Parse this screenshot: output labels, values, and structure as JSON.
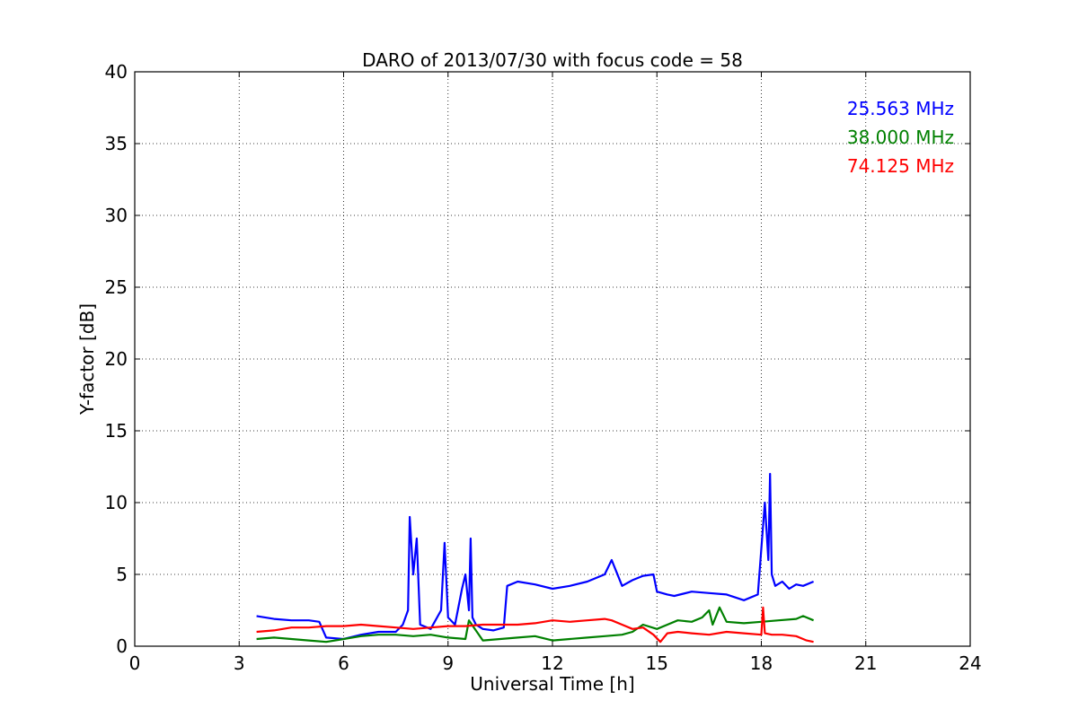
{
  "chart_data": {
    "type": "line",
    "title": "DARO of 2013/07/30 with focus code = 58",
    "xlabel": "Universal Time [h]",
    "ylabel": "Y-factor [dB]",
    "xlim": [
      0,
      24
    ],
    "ylim": [
      0,
      40
    ],
    "xticks": [
      0,
      3,
      6,
      9,
      12,
      15,
      18,
      21,
      24
    ],
    "yticks": [
      0,
      5,
      10,
      15,
      20,
      25,
      30,
      35,
      40
    ],
    "xtick_labels": [
      "0",
      "3",
      "6",
      "9",
      "12",
      "15",
      "18",
      "21",
      "24"
    ],
    "ytick_labels": [
      "0",
      "5",
      "10",
      "15",
      "20",
      "25",
      "30",
      "35",
      "40"
    ],
    "grid": true,
    "legend_position": "top-right",
    "series": [
      {
        "name": "25.563 MHz",
        "color": "#0000ff",
        "x": [
          3.5,
          4.0,
          4.5,
          5.0,
          5.3,
          5.5,
          6.0,
          6.5,
          7.0,
          7.5,
          7.7,
          7.85,
          7.9,
          8.0,
          8.1,
          8.2,
          8.5,
          8.8,
          8.9,
          9.0,
          9.2,
          9.4,
          9.5,
          9.6,
          9.65,
          9.7,
          9.8,
          10.0,
          10.3,
          10.6,
          10.7,
          11.0,
          11.5,
          12.0,
          12.5,
          13.0,
          13.5,
          13.7,
          14.0,
          14.3,
          14.6,
          14.9,
          15.0,
          15.3,
          15.5,
          16.0,
          16.5,
          17.0,
          17.5,
          17.9,
          18.1,
          18.2,
          18.25,
          18.3,
          18.4,
          18.6,
          18.8,
          19.0,
          19.2,
          19.5
        ],
        "y": [
          2.1,
          1.9,
          1.8,
          1.8,
          1.7,
          0.6,
          0.5,
          0.8,
          1.0,
          1.0,
          1.5,
          2.5,
          9.0,
          5.0,
          7.5,
          1.5,
          1.2,
          2.5,
          7.2,
          2.0,
          1.5,
          4.0,
          5.0,
          2.5,
          7.5,
          2.0,
          1.5,
          1.2,
          1.1,
          1.3,
          4.2,
          4.5,
          4.3,
          4.0,
          4.2,
          4.5,
          5.0,
          6.0,
          4.2,
          4.6,
          4.9,
          5.0,
          3.8,
          3.6,
          3.5,
          3.8,
          3.7,
          3.6,
          3.2,
          3.6,
          10.0,
          6.0,
          12.0,
          5.0,
          4.2,
          4.5,
          4.0,
          4.3,
          4.2,
          4.5
        ]
      },
      {
        "name": "38.000 MHz",
        "color": "#008000",
        "x": [
          3.5,
          4.0,
          4.5,
          5.0,
          5.5,
          6.0,
          6.5,
          7.0,
          7.5,
          8.0,
          8.5,
          9.0,
          9.5,
          9.6,
          10.0,
          10.5,
          11.0,
          11.5,
          12.0,
          12.5,
          13.0,
          13.5,
          14.0,
          14.3,
          14.6,
          15.0,
          15.3,
          15.6,
          16.0,
          16.3,
          16.5,
          16.6,
          16.8,
          17.0,
          17.5,
          18.0,
          18.5,
          19.0,
          19.2,
          19.5
        ],
        "y": [
          0.5,
          0.6,
          0.5,
          0.4,
          0.3,
          0.5,
          0.7,
          0.8,
          0.8,
          0.7,
          0.8,
          0.6,
          0.5,
          1.8,
          0.4,
          0.5,
          0.6,
          0.7,
          0.4,
          0.5,
          0.6,
          0.7,
          0.8,
          1.0,
          1.5,
          1.2,
          1.5,
          1.8,
          1.7,
          2.0,
          2.5,
          1.5,
          2.7,
          1.7,
          1.6,
          1.7,
          1.8,
          1.9,
          2.1,
          1.8
        ]
      },
      {
        "name": "74.125 MHz",
        "color": "#ff0000",
        "x": [
          3.5,
          4.0,
          4.5,
          5.0,
          5.5,
          6.0,
          6.5,
          7.0,
          7.5,
          8.0,
          8.5,
          9.0,
          9.5,
          10.0,
          10.5,
          11.0,
          11.5,
          12.0,
          12.5,
          13.0,
          13.5,
          13.7,
          14.0,
          14.3,
          14.6,
          14.9,
          15.1,
          15.3,
          15.6,
          16.0,
          16.5,
          17.0,
          17.5,
          18.0,
          18.05,
          18.1,
          18.3,
          18.6,
          19.0,
          19.3,
          19.5
        ],
        "y": [
          1.0,
          1.1,
          1.3,
          1.3,
          1.4,
          1.4,
          1.5,
          1.4,
          1.3,
          1.2,
          1.3,
          1.4,
          1.4,
          1.5,
          1.5,
          1.5,
          1.6,
          1.8,
          1.7,
          1.8,
          1.9,
          1.8,
          1.5,
          1.2,
          1.3,
          0.8,
          0.3,
          0.9,
          1.0,
          0.9,
          0.8,
          1.0,
          0.9,
          0.8,
          2.7,
          0.9,
          0.8,
          0.8,
          0.7,
          0.4,
          0.3
        ]
      }
    ]
  }
}
